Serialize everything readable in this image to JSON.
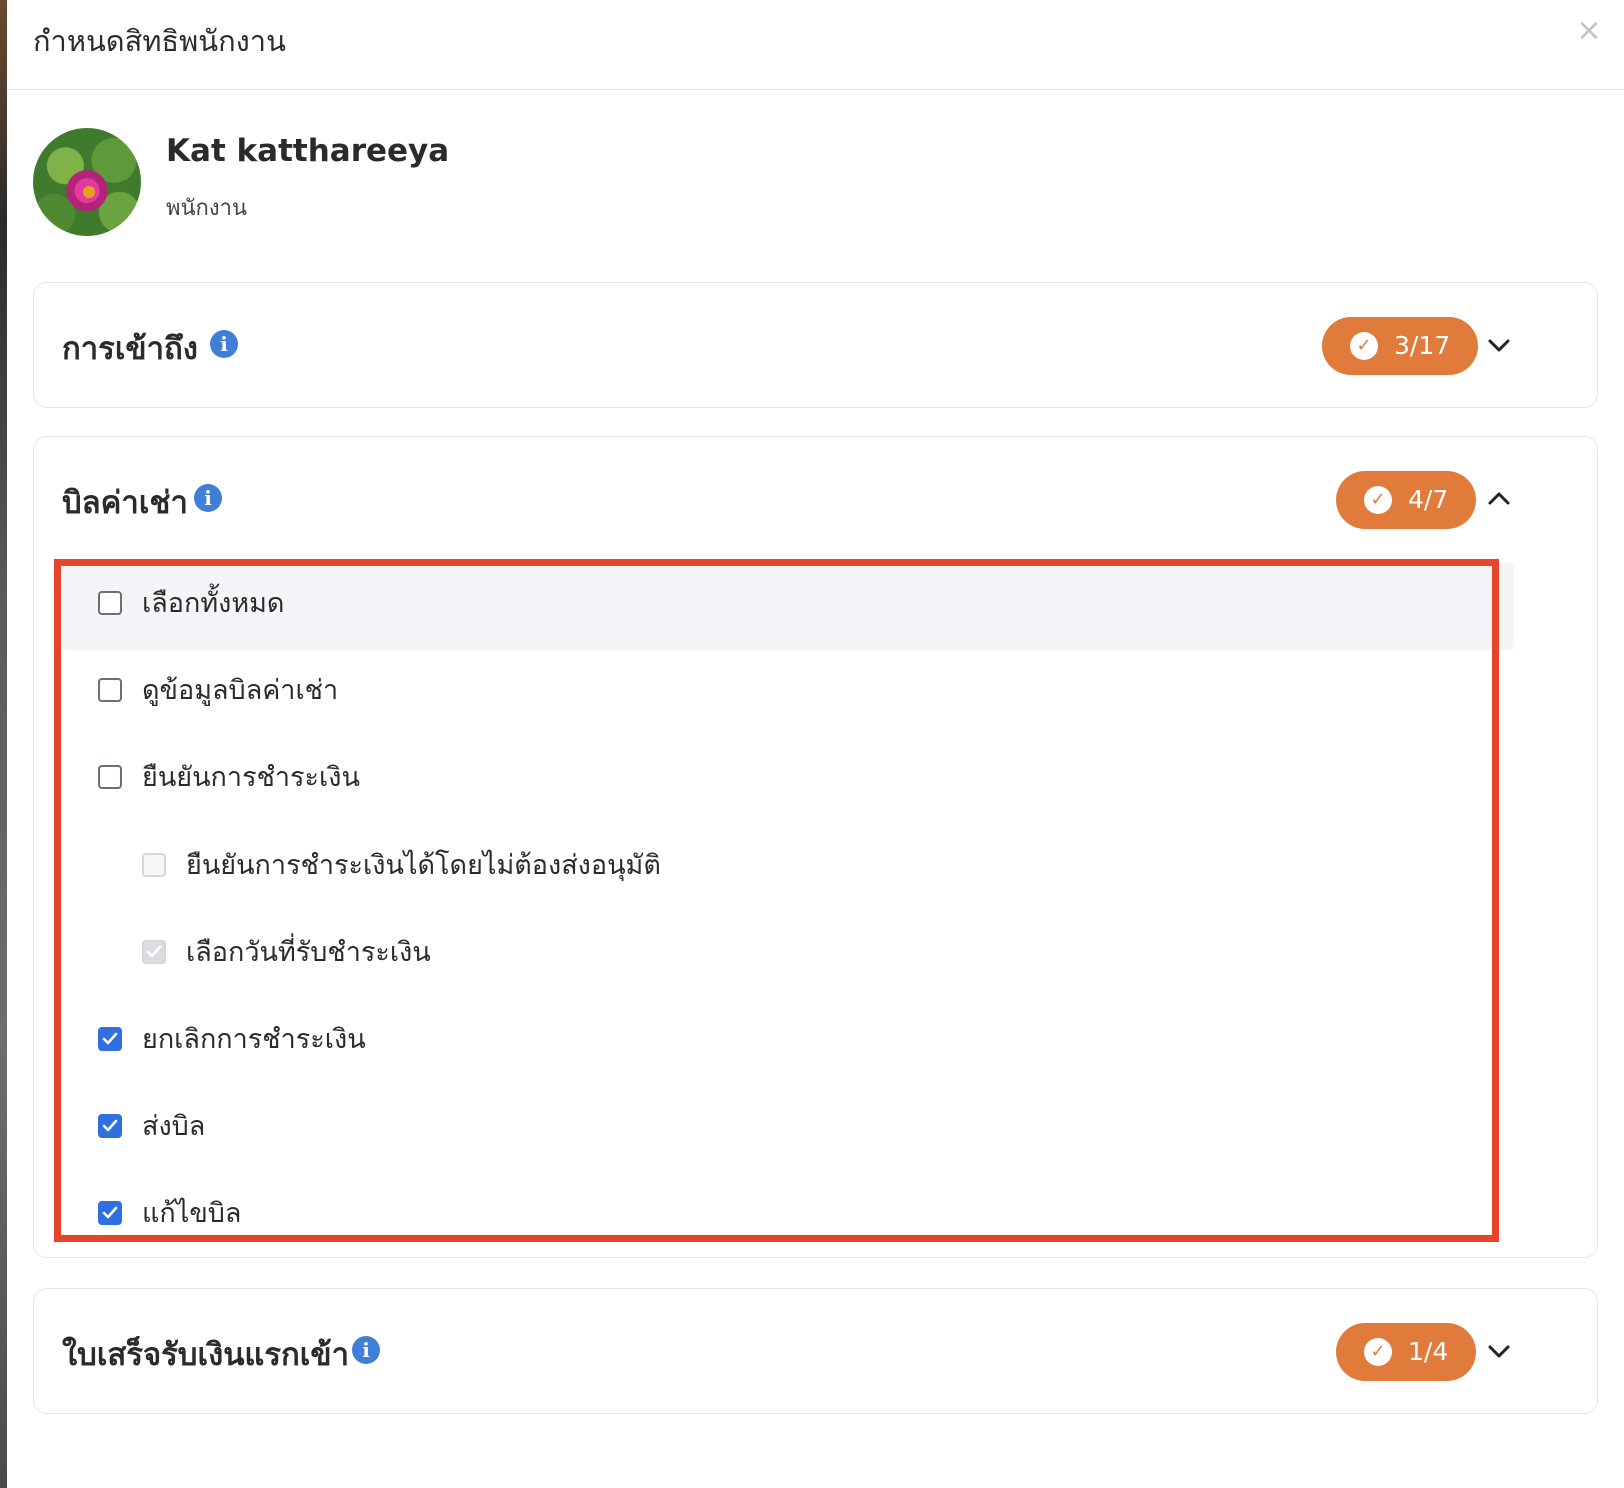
{
  "modal": {
    "title": "กำหนดสิทธิพนักงาน",
    "close_label": "×"
  },
  "user": {
    "name": "Kat katthareeya",
    "role": "พนักงาน"
  },
  "sections": [
    {
      "title": "การเข้าถึง",
      "badge": "3/17",
      "expanded": false
    },
    {
      "title": "บิลค่าเช่า",
      "badge": "4/7",
      "expanded": true,
      "select_all_label": "เลือกทั้งหมด",
      "permissions": [
        {
          "label": "ดูข้อมูลบิลค่าเช่า",
          "checked": false,
          "disabled": false,
          "indent": false
        },
        {
          "label": "ยืนยันการชำระเงิน",
          "checked": false,
          "disabled": false,
          "indent": false
        },
        {
          "label": "ยืนยันการชำระเงินได้โดยไม่ต้องส่งอนุมัติ",
          "checked": false,
          "disabled": true,
          "indent": true
        },
        {
          "label": "เลือกวันที่รับชำระเงิน",
          "checked": true,
          "disabled": true,
          "indent": true
        },
        {
          "label": "ยกเลิกการชำระเงิน",
          "checked": true,
          "disabled": false,
          "indent": false
        },
        {
          "label": "ส่งบิล",
          "checked": true,
          "disabled": false,
          "indent": false
        },
        {
          "label": "แก้ไขบิล",
          "checked": true,
          "disabled": false,
          "indent": false
        }
      ]
    },
    {
      "title": "ใบเสร็จรับเงินแรกเข้า",
      "badge": "1/4",
      "expanded": false
    }
  ],
  "icons": {
    "info": "info-icon",
    "badge_check": "check-circle-icon",
    "close": "close-icon",
    "expand": "chevron-down-icon",
    "collapse": "chevron-up-icon"
  },
  "colors": {
    "badge": "#e07b3c",
    "checkbox_checked": "#2f6fe0",
    "info_icon": "#3f7fd6",
    "highlight_border": "#e8442a"
  }
}
